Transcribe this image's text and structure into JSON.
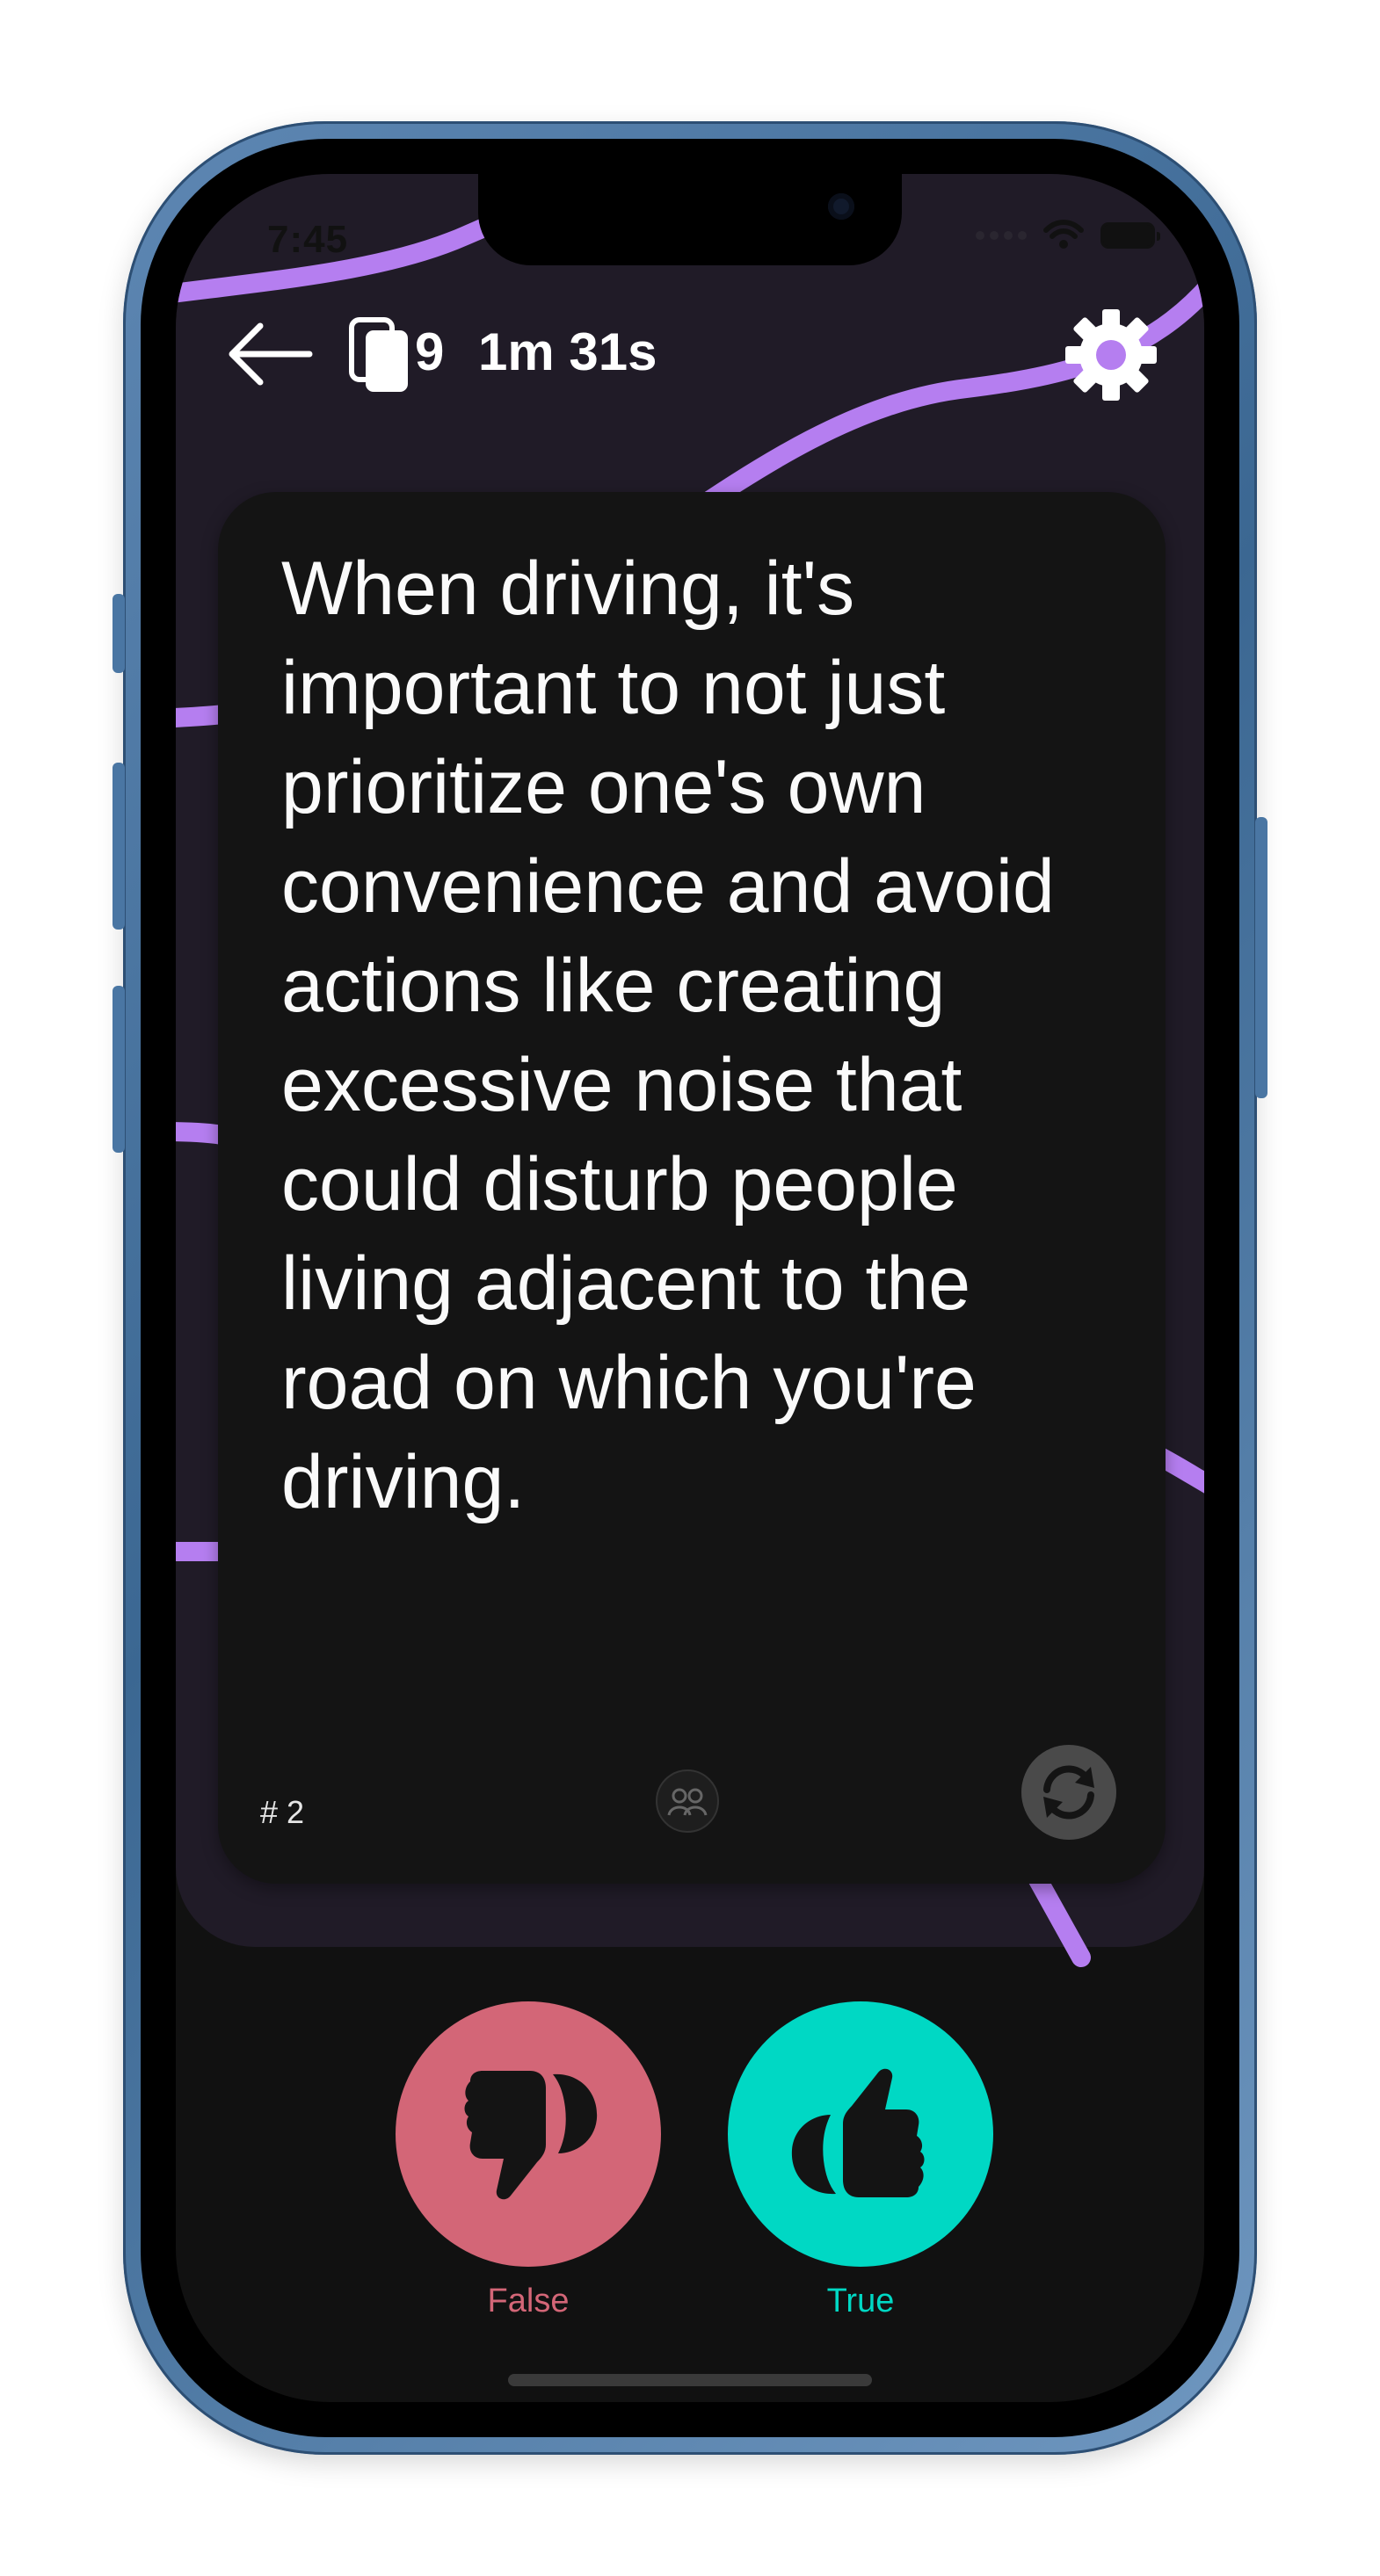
{
  "status_bar": {
    "time": "7:45",
    "icons": [
      "signal-icon",
      "wifi-icon",
      "battery-icon"
    ]
  },
  "header": {
    "back_icon": "arrow-left-icon",
    "deck_icon": "card-stack-icon",
    "card_count": "9",
    "timer": "1m 31s",
    "settings_icon": "gear-icon"
  },
  "card": {
    "text": "When driving, it's important to not just prioritize one's own convenience and avoid actions like creating excessive noise that could disturb people living adjacent to the road on which you're driving.",
    "number": "# 2",
    "logo_icon": "people-logo-icon",
    "flip_icon": "refresh-icon"
  },
  "answers": {
    "false_label": "False",
    "true_label": "True",
    "false_icon": "thumbs-down-icon",
    "true_icon": "thumbs-up-icon"
  },
  "colors": {
    "accent_line": "#b57ef0",
    "false": "#d36677",
    "true": "#00d8c4",
    "card_bg": "#141414",
    "screen_bg": "#201b27"
  }
}
